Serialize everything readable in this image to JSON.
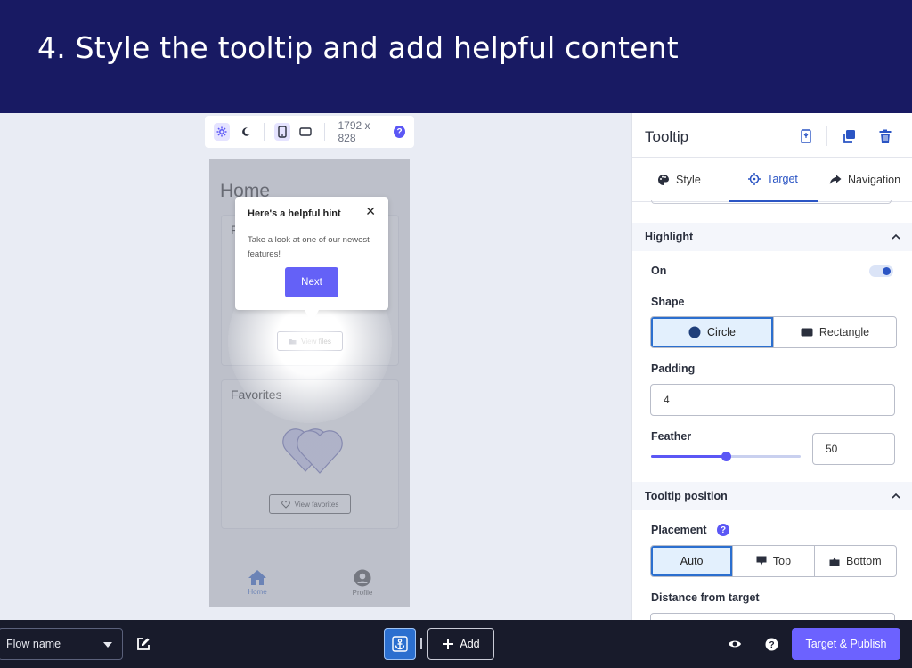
{
  "banner": {
    "title": "4. Style the tooltip and add helpful content"
  },
  "device_toolbar": {
    "icons": [
      "settings-icon",
      "moon-icon",
      "phone-icon",
      "tablet-landscape-icon"
    ],
    "dimensions": "1792 x 828",
    "help": "?"
  },
  "phone": {
    "page_title": "Home",
    "card1_label": "F",
    "card2_label": "Favorites",
    "view_files": "View files",
    "view_favorites": "View favorites",
    "nav": [
      {
        "label": "Home",
        "icon": "home-icon",
        "active": true
      },
      {
        "label": "Profile",
        "icon": "profile-icon",
        "active": false
      }
    ]
  },
  "tooltip": {
    "title": "Here's a helpful hint",
    "close": "✕",
    "body": "Take a look at one of our newest features!",
    "next": "Next"
  },
  "panel": {
    "title": "Tooltip",
    "header_icons": [
      "mobile-icon",
      "duplicate-icon",
      "trash-icon"
    ],
    "tabs": [
      {
        "label": "Style",
        "icon": "palette-icon"
      },
      {
        "label": "Target",
        "icon": "crosshair-icon"
      },
      {
        "label": "Navigation",
        "icon": "share-arrow-icon"
      }
    ],
    "active_tab": "Target",
    "highlight": {
      "section_title": "Highlight",
      "on_label": "On",
      "on_value": true,
      "shape_label": "Shape",
      "shape_options": [
        "Circle",
        "Rectangle"
      ],
      "shape_selected": "Circle",
      "padding_label": "Padding",
      "padding_value": "4",
      "feather_label": "Feather",
      "feather_value": "50",
      "feather_slider_fraction": 0.5
    },
    "tooltip_position": {
      "section_title": "Tooltip position",
      "placement_label": "Placement",
      "placement_options": [
        "Auto",
        "Top",
        "Bottom"
      ],
      "placement_selected": "Auto",
      "distance_label": "Distance from target"
    }
  },
  "bottom_bar": {
    "flow_name": "Flow name",
    "add_label": "Add",
    "publish_label": "Target & Publish"
  },
  "colors": {
    "banner_bg": "#181a63",
    "accent": "#5b57f5",
    "publish": "#6c62ff",
    "selected_blue": "#2b6fcf",
    "bottom_bar": "#181b2b"
  }
}
